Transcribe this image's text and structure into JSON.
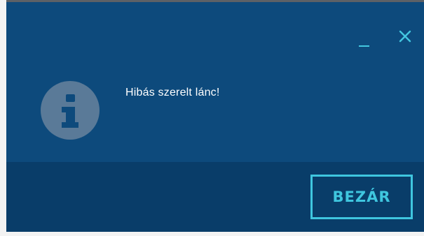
{
  "dialog": {
    "message": "Hibás szerelt lánc!",
    "close_button_label": "BEZÁR"
  },
  "icons": {
    "info": "info-icon",
    "minimize": "minimize-icon",
    "close": "close-icon"
  },
  "colors": {
    "dialog_background": "#0d4a7c",
    "footer_background": "#093d69",
    "accent": "#3fc6df",
    "message_text": "#ffffff"
  }
}
